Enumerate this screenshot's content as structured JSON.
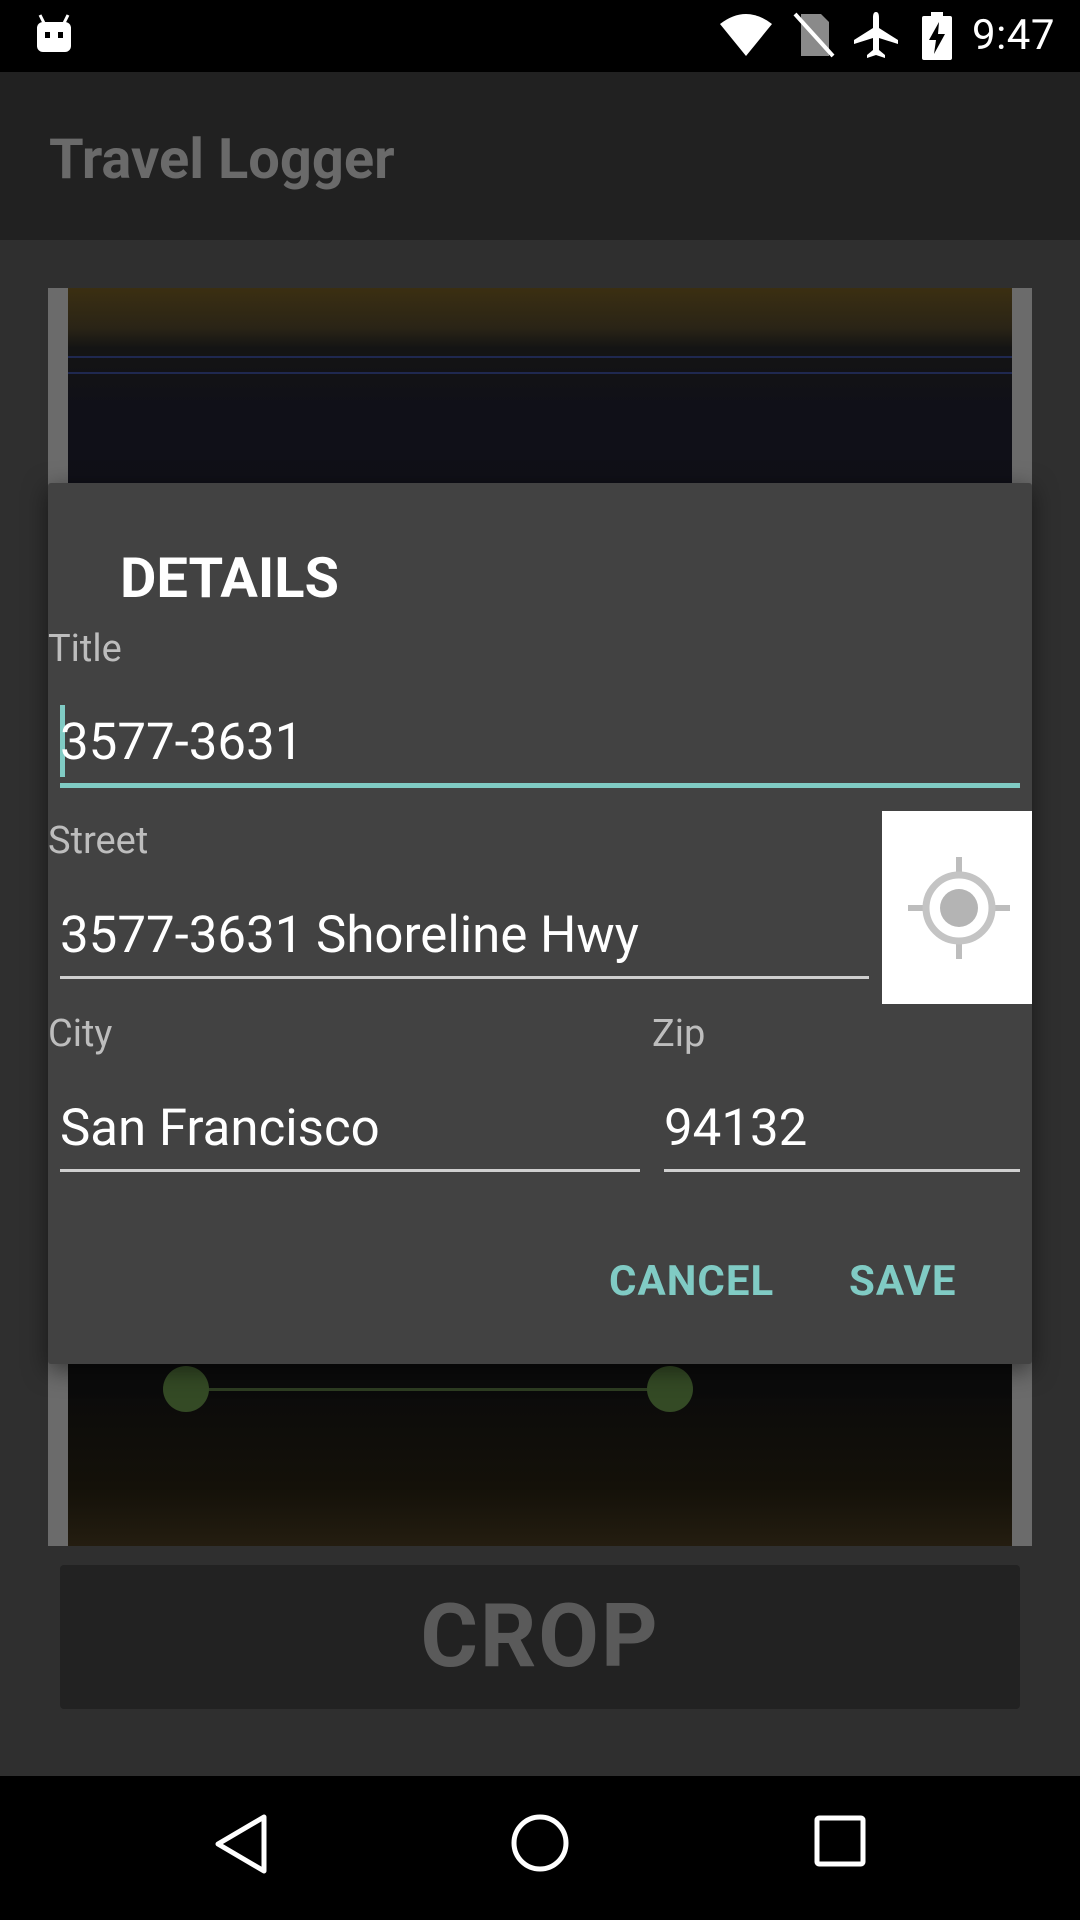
{
  "status_bar": {
    "time": "9:47",
    "icons": [
      "android-icon",
      "wifi-icon",
      "no-sim-icon",
      "airplane-icon",
      "battery-charging-icon"
    ]
  },
  "app": {
    "title": "Travel Logger"
  },
  "background": {
    "crop_button_label": "CROP"
  },
  "dialog": {
    "title": "DETAILS",
    "fields": {
      "title": {
        "label": "Title",
        "value": "3577-3631"
      },
      "street": {
        "label": "Street",
        "value": "3577-3631 Shoreline Hwy"
      },
      "city": {
        "label": "City",
        "value": "San Francisco"
      },
      "zip": {
        "label": "Zip",
        "value": "94132"
      }
    },
    "locate_icon": "my-location-icon",
    "actions": {
      "cancel": "CANCEL",
      "save": "SAVE"
    }
  },
  "colors": {
    "accent": "#80cbc4",
    "dialog_background": "#424242",
    "scrim": "#2f2f2f"
  },
  "nav_bar": {
    "icons": [
      "back-icon",
      "home-icon",
      "recents-icon"
    ]
  }
}
